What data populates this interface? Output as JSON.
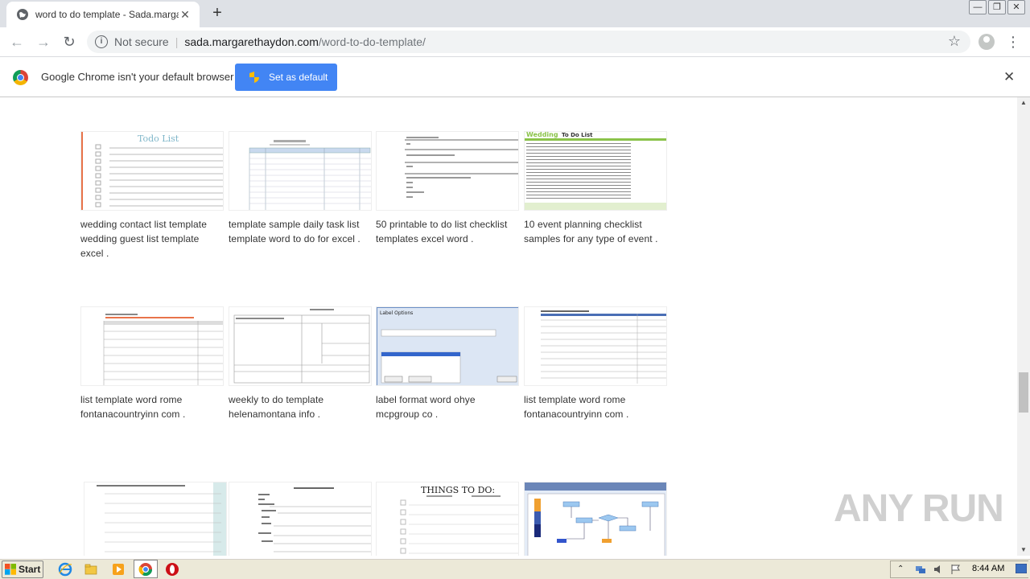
{
  "browser": {
    "tab_title": "word to do template - Sada.margaret",
    "tab_close": "✕",
    "new_tab": "+",
    "not_secure": "Not secure",
    "url_host": "sada.margarethaydon.com",
    "url_path": "/word-to-do-template/",
    "window_buttons": [
      "—",
      "❐",
      "✕"
    ]
  },
  "infobar": {
    "message": "Google Chrome isn't your default browser",
    "button_label": "Set as default",
    "close": "✕"
  },
  "results": [
    {
      "caption": "wedding contact list template wedding guest list template excel ."
    },
    {
      "caption": "template sample daily task list template word to do for excel ."
    },
    {
      "caption": "50 printable to do list checklist templates excel word ."
    },
    {
      "caption": "10 event planning checklist samples for any type of event ."
    },
    {
      "caption": "list template word rome fontanacountryinn com ."
    },
    {
      "caption": "weekly to do template helenamontana info ."
    },
    {
      "caption": "label format word ohye mcpgroup co ."
    },
    {
      "caption": "list template word rome fontanacountryinn com ."
    },
    {
      "caption": ""
    },
    {
      "caption": ""
    },
    {
      "caption": ""
    },
    {
      "caption": ""
    }
  ],
  "thumb_texts": {
    "todo_list": "Todo List",
    "wedding": "Wedding",
    "to_do_list": "To Do List",
    "things_to_do": "THINGS TO DO:",
    "label_options": "Label Options"
  },
  "watermark": "ANY RUN",
  "taskbar": {
    "start_label": "Start",
    "clock": "8:44 AM"
  }
}
